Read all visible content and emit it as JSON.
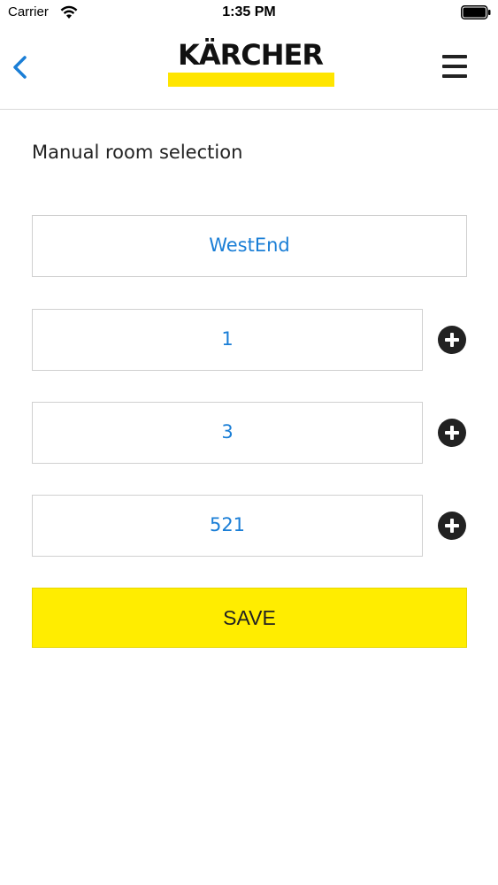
{
  "status_bar": {
    "carrier": "Carrier",
    "time": "1:35 PM"
  },
  "header": {
    "logo_text": "KÄRCHER",
    "back_icon": "chevron-left-icon",
    "menu_icon": "hamburger-menu-icon"
  },
  "page": {
    "title": "Manual room selection"
  },
  "fields": {
    "building": "WestEnd",
    "floor": "1",
    "section": "3",
    "room": "521"
  },
  "actions": {
    "save_label": "SAVE",
    "add_icon": "plus-circle-icon"
  },
  "colors": {
    "accent_yellow": "#ffed00",
    "value_blue": "#1a7ed6",
    "back_blue": "#1a7ed6",
    "dark": "#222222"
  }
}
